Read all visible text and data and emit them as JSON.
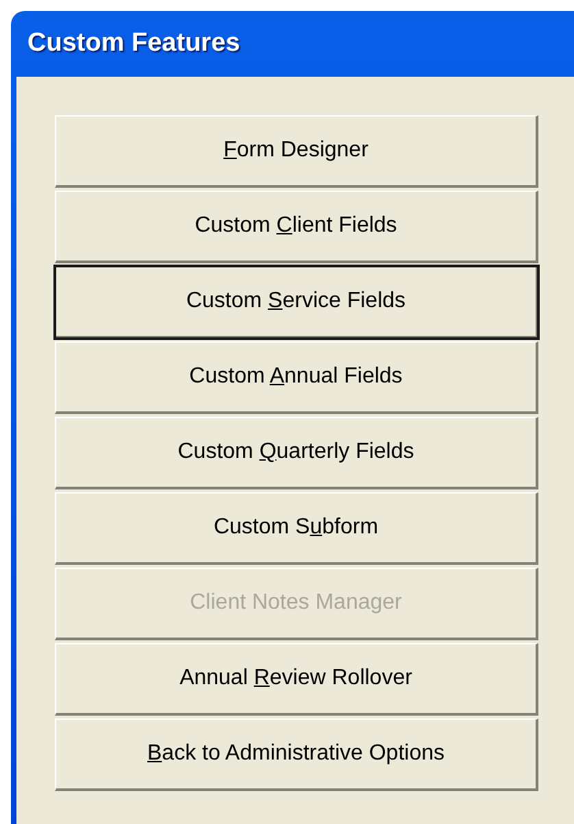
{
  "window": {
    "title": "Custom Features"
  },
  "buttons": [
    {
      "access_key": "F",
      "after": "orm Designer",
      "focused": false,
      "disabled": false
    },
    {
      "before": "Custom ",
      "access_key": "C",
      "after": "lient Fields",
      "focused": false,
      "disabled": false
    },
    {
      "before": "Custom ",
      "access_key": "S",
      "after": "ervice Fields",
      "focused": true,
      "disabled": false
    },
    {
      "before": "Custom ",
      "access_key": "A",
      "after": "nnual Fields",
      "focused": false,
      "disabled": false
    },
    {
      "before": "Custom ",
      "access_key": "Q",
      "after": "uarterly Fields",
      "focused": false,
      "disabled": false
    },
    {
      "before": "Custom S",
      "access_key": "u",
      "after": "bform",
      "focused": false,
      "disabled": false
    },
    {
      "before": "Client Notes Manager",
      "focused": false,
      "disabled": true
    },
    {
      "before": "Annual ",
      "access_key": "R",
      "after": "eview Rollover",
      "focused": false,
      "disabled": false
    },
    {
      "access_key": "B",
      "after": "ack to Administrative Options",
      "focused": false,
      "disabled": false
    }
  ]
}
